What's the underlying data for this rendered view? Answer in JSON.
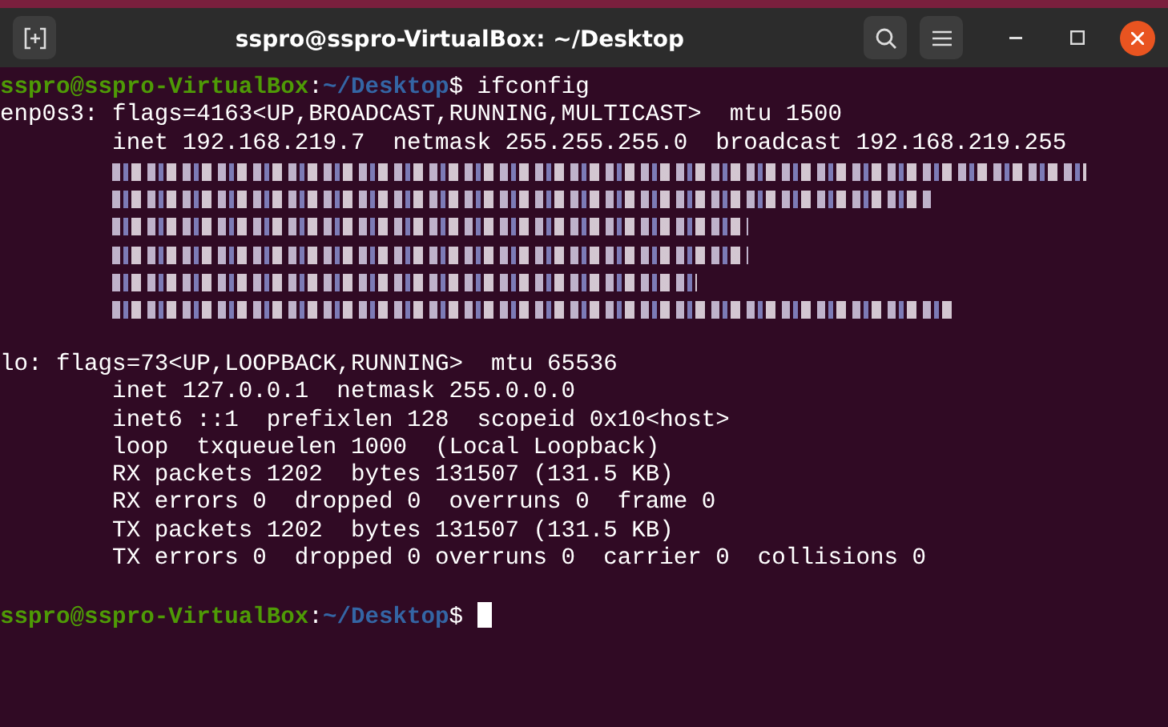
{
  "window": {
    "title": "sspro@sspro-VirtualBox: ~/Desktop"
  },
  "terminal": {
    "lines": [
      {
        "kind": "prompt",
        "user": "sspro@sspro-VirtualBox",
        "separator": ":",
        "path": "~/Desktop",
        "symbol": "$",
        "command": "ifconfig"
      },
      {
        "kind": "text",
        "text": "enp0s3: flags=4163<UP,BROADCAST,RUNNING,MULTICAST>  mtu 1500"
      },
      {
        "kind": "text",
        "text": "        inet 192.168.219.7  netmask 255.255.255.0  broadcast 192.168.219.255"
      },
      {
        "kind": "obscured"
      },
      {
        "kind": "obscured"
      },
      {
        "kind": "obscured"
      },
      {
        "kind": "obscured"
      },
      {
        "kind": "obscured"
      },
      {
        "kind": "obscured"
      },
      {
        "kind": "blank"
      },
      {
        "kind": "text",
        "text": "lo: flags=73<UP,LOOPBACK,RUNNING>  mtu 65536"
      },
      {
        "kind": "text",
        "text": "        inet 127.0.0.1  netmask 255.0.0.0"
      },
      {
        "kind": "text",
        "text": "        inet6 ::1  prefixlen 128  scopeid 0x10<host>"
      },
      {
        "kind": "text",
        "text": "        loop  txqueuelen 1000  (Local Loopback)"
      },
      {
        "kind": "text",
        "text": "        RX packets 1202  bytes 131507 (131.5 KB)"
      },
      {
        "kind": "text",
        "text": "        RX errors 0  dropped 0  overruns 0  frame 0"
      },
      {
        "kind": "text",
        "text": "        TX packets 1202  bytes 131507 (131.5 KB)"
      },
      {
        "kind": "text",
        "text": "        TX errors 0  dropped 0 overruns 0  carrier 0  collisions 0"
      },
      {
        "kind": "blank"
      },
      {
        "kind": "prompt",
        "user": "sspro@sspro-VirtualBox",
        "separator": ":",
        "path": "~/Desktop",
        "symbol": "$",
        "cursor": true
      }
    ]
  }
}
